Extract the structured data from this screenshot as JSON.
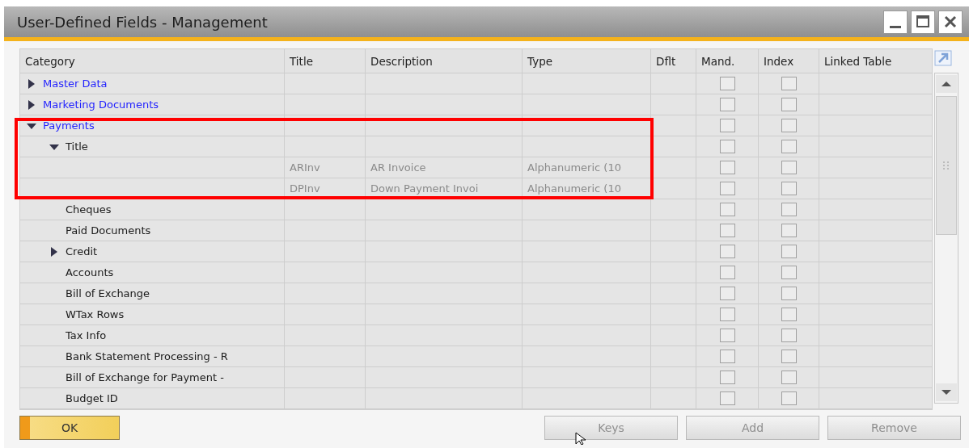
{
  "window": {
    "title": "User-Defined Fields - Management"
  },
  "table": {
    "columns": [
      "Category",
      "Title",
      "Description",
      "Type",
      "Dflt",
      "Mand.",
      "Index",
      "Linked Table"
    ],
    "rows": [
      {
        "kind": "category",
        "category": "Master Data",
        "expanded": false,
        "mandatory": false,
        "index": false
      },
      {
        "kind": "category",
        "category": "Marketing Documents",
        "expanded": false,
        "mandatory": false,
        "index": false
      },
      {
        "kind": "category",
        "category": "Payments",
        "expanded": true,
        "mandatory": false,
        "index": false,
        "children": [
          {
            "kind": "category",
            "category": "Title",
            "expanded": true,
            "mandatory": false,
            "index": false,
            "children": [
              {
                "kind": "field",
                "title": "ARInv",
                "description": "AR Invoice",
                "type": "Alphanumeric (10",
                "mandatory": false,
                "index": false
              },
              {
                "kind": "field",
                "title": "DPInv",
                "description": "Down Payment Invoi",
                "type": "Alphanumeric (10",
                "mandatory": false,
                "index": false
              }
            ]
          },
          {
            "kind": "category",
            "category": "Cheques",
            "mandatory": false,
            "index": false
          },
          {
            "kind": "category",
            "category": "Paid Documents",
            "mandatory": false,
            "index": false
          },
          {
            "kind": "category",
            "category": "Credit",
            "expanded": false,
            "mandatory": false,
            "index": false
          },
          {
            "kind": "category",
            "category": "Accounts",
            "mandatory": false,
            "index": false
          },
          {
            "kind": "category",
            "category": "Bill of Exchange",
            "mandatory": false,
            "index": false
          },
          {
            "kind": "category",
            "category": "WTax Rows",
            "mandatory": false,
            "index": false
          },
          {
            "kind": "category",
            "category": "Tax Info",
            "mandatory": false,
            "index": false
          },
          {
            "kind": "category",
            "category": "Bank Statement Processing - R",
            "mandatory": false,
            "index": false
          },
          {
            "kind": "category",
            "category": "Bill of Exchange for Payment -",
            "mandatory": false,
            "index": false
          },
          {
            "kind": "category",
            "category": "Budget ID",
            "mandatory": false,
            "index": false
          }
        ]
      }
    ]
  },
  "buttons": [
    {
      "label": "OK",
      "kind": "primary"
    },
    {
      "label": "Keys",
      "kind": "secondary"
    },
    {
      "label": "Add",
      "kind": "secondary"
    },
    {
      "label": "Remove",
      "kind": "secondary"
    }
  ]
}
